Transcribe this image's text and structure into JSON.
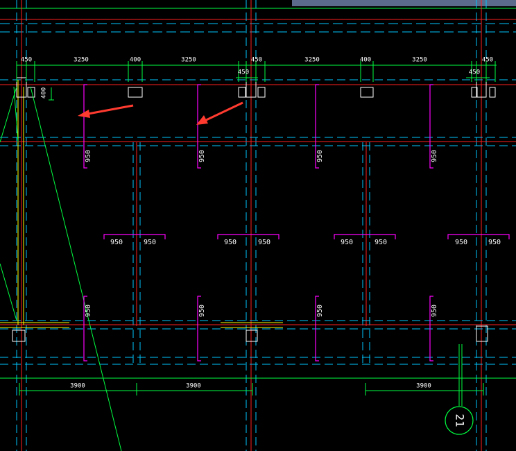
{
  "drawing": {
    "top_dimensions": [
      "450",
      "3250",
      "400",
      "3250",
      "450",
      "3250",
      "400",
      "3250",
      "450"
    ],
    "offset_450_labels": [
      "450",
      "450"
    ],
    "column_depth_label": "400",
    "vertical_950_labels": [
      "950",
      "950",
      "950",
      "950",
      "950",
      "950",
      "950",
      "950"
    ],
    "horizontal_950_labels": [
      "950",
      "950",
      "950",
      "950",
      "950",
      "950",
      "950",
      "950"
    ],
    "bottom_dimensions": [
      "3900",
      "3900",
      "3900"
    ],
    "axis_marker": "21",
    "colors": {
      "background": "#000000",
      "axis_line": "#ff2020",
      "grid_dash": "#00c8ff",
      "dimension": "#00ff40",
      "beam": "#ff00ff",
      "wall": "#ffff00",
      "outline": "#ffffff",
      "arrow": "#ff3b30",
      "window_bar": "#5a6b8c"
    }
  }
}
